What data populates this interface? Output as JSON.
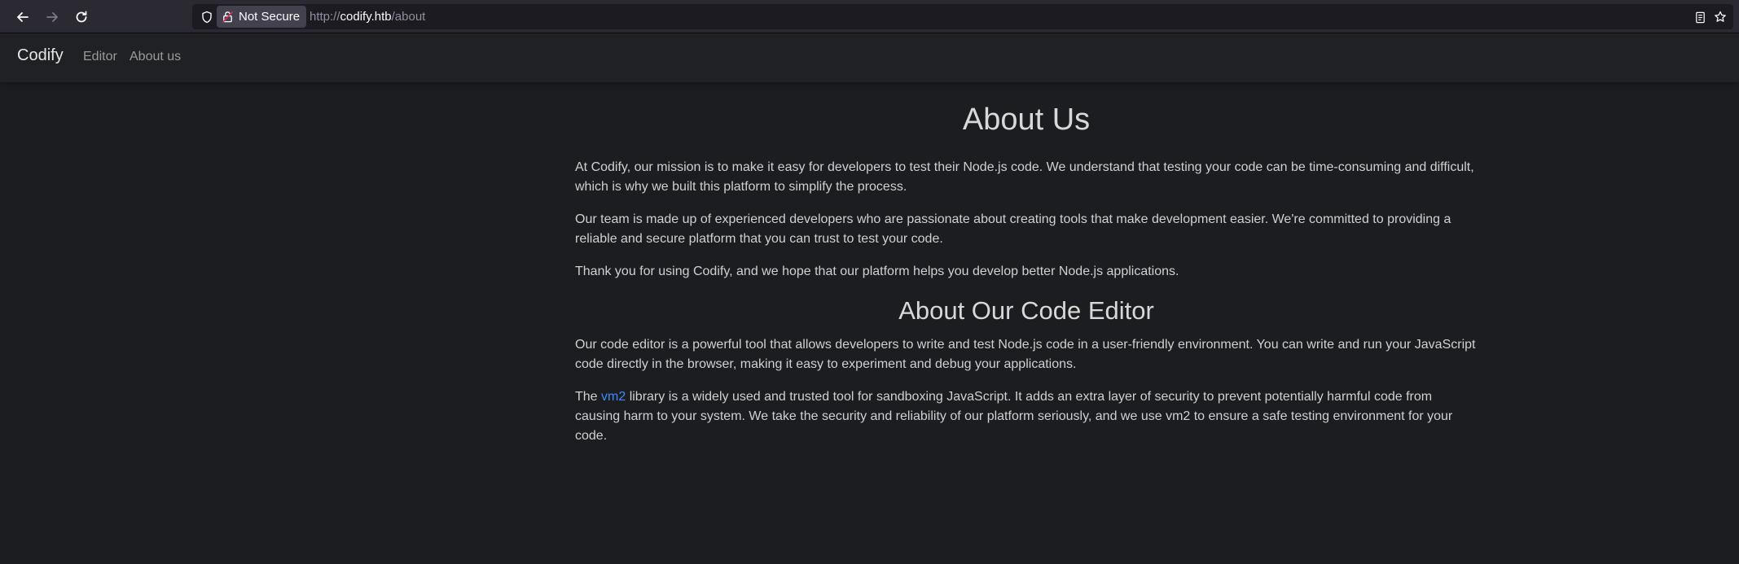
{
  "browser": {
    "security_label": "Not Secure",
    "url_protocol": "http://",
    "url_host": "codify.htb",
    "url_path": "/about"
  },
  "navbar": {
    "brand": "Codify",
    "links": [
      "Editor",
      "About us"
    ]
  },
  "about": {
    "title": "About Us",
    "paragraphs": [
      "At Codify, our mission is to make it easy for developers to test their Node.js code. We understand that testing your code can be time-consuming and difficult, which is why we built this platform to simplify the process.",
      "Our team is made up of experienced developers who are passionate about creating tools that make development easier. We're committed to providing a reliable and secure platform that you can trust to test your code.",
      "Thank you for using Codify, and we hope that our platform helps you develop better Node.js applications."
    ]
  },
  "editor_section": {
    "title": "About Our Code Editor",
    "paragraph1": "Our code editor is a powerful tool that allows developers to write and test Node.js code in a user-friendly environment. You can write and run your JavaScript code directly in the browser, making it easy to experiment and debug your applications.",
    "p2_before": "The ",
    "p2_link": "vm2",
    "p2_after": " library is a widely used and trusted tool for sandboxing JavaScript. It adds an extra layer of security to prevent potentially harmful code from causing harm to your system. We take the security and reliability of our platform seriously, and we use vm2 to ensure a safe testing environment for your code."
  }
}
